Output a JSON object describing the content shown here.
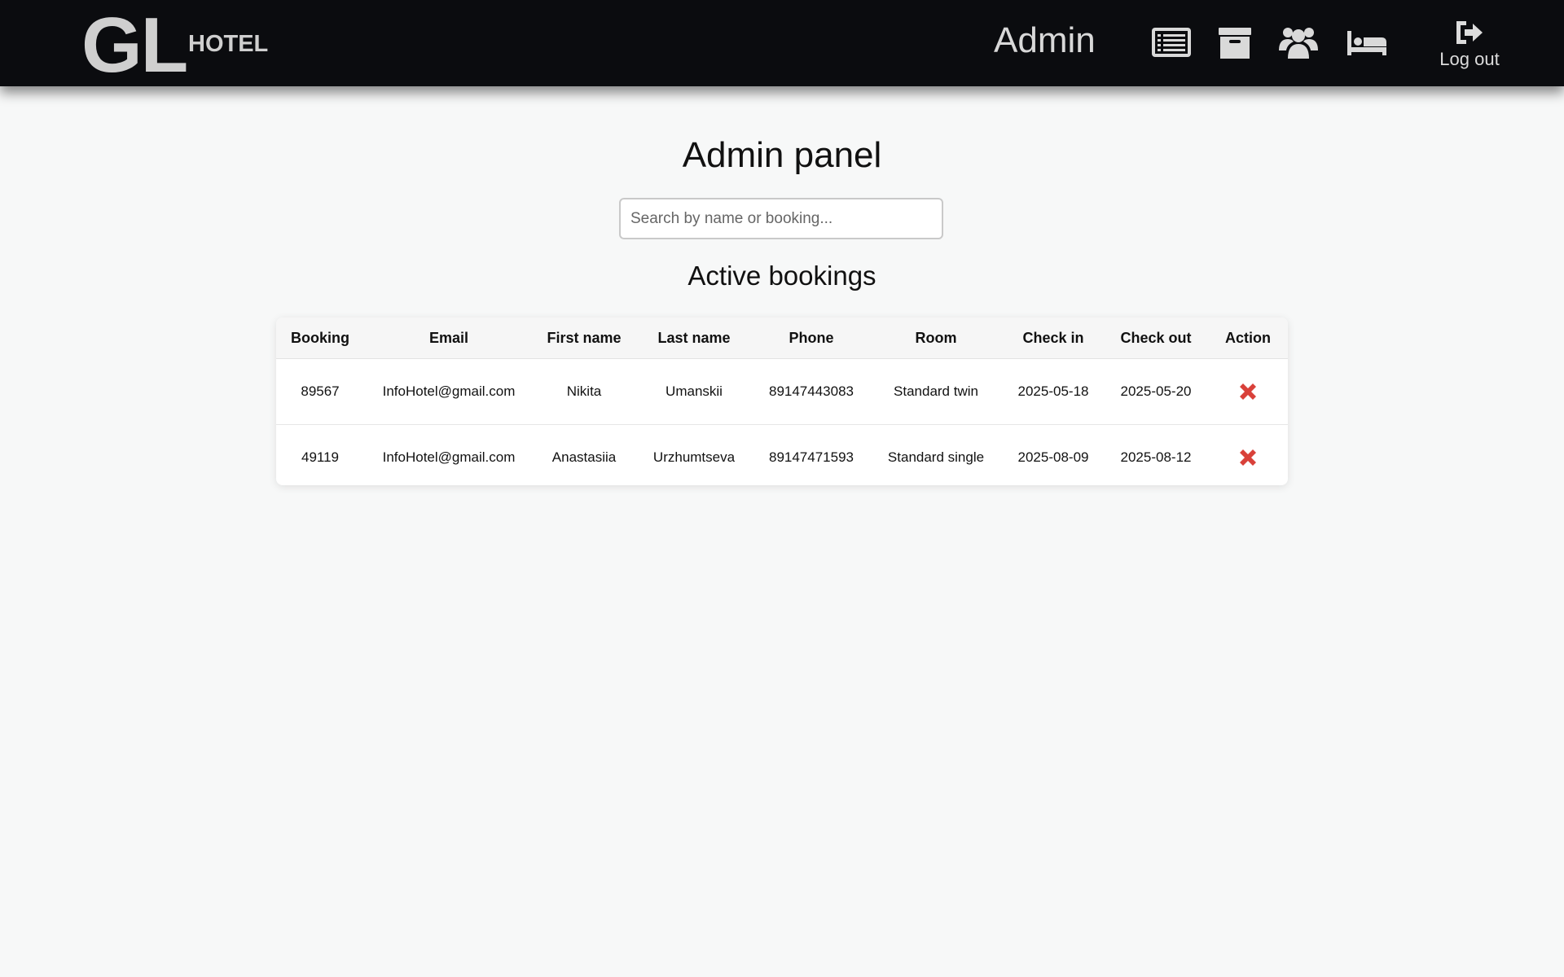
{
  "header": {
    "logo_main": "GL",
    "logo_sub": "HOTEL",
    "role": "Admin",
    "nav": [
      {
        "icon": "list-icon"
      },
      {
        "icon": "archive-icon"
      },
      {
        "icon": "users-icon"
      },
      {
        "icon": "bed-icon"
      }
    ],
    "logout_label": "Log out"
  },
  "page": {
    "title": "Admin panel",
    "search_placeholder": "Search by name or booking...",
    "section_title": "Active bookings"
  },
  "table": {
    "columns": [
      "Booking",
      "Email",
      "First name",
      "Last name",
      "Phone",
      "Room",
      "Check in",
      "Check out",
      "Action"
    ],
    "rows": [
      {
        "booking": "89567",
        "email": "InfoHotel@gmail.com",
        "first_name": "Nikita",
        "last_name": "Umanskii",
        "phone": "89147443083",
        "room": "Standard twin",
        "check_in": "2025-05-18",
        "check_out": "2025-05-20",
        "action_icon": "delete-x-icon"
      },
      {
        "booking": "49119",
        "email": "InfoHotel@gmail.com",
        "first_name": "Anastasiia",
        "last_name": "Urzhumtseva",
        "phone": "89147471593",
        "room": "Standard single",
        "check_in": "2025-08-09",
        "check_out": "2025-08-12",
        "action_icon": "delete-x-icon"
      }
    ]
  },
  "colors": {
    "header_bg": "#0b0c0f",
    "page_bg": "#f7f8f8",
    "icon_gray": "#d9d9d9",
    "delete_red": "#d9413a"
  }
}
